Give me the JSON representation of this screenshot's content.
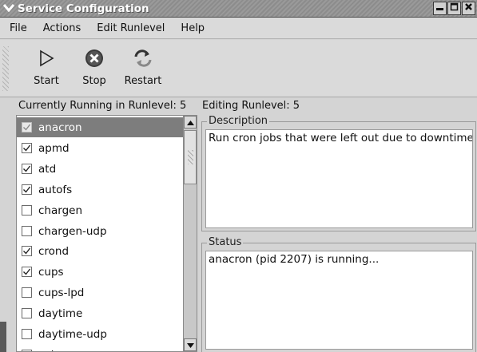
{
  "window": {
    "title": "Service Configuration"
  },
  "menu": [
    {
      "label": "File"
    },
    {
      "label": "Actions"
    },
    {
      "label": "Edit Runlevel"
    },
    {
      "label": "Help"
    }
  ],
  "toolbar": {
    "start_label": "Start",
    "stop_label": "Stop",
    "restart_label": "Restart"
  },
  "runlevel": {
    "current": "Currently Running in Runlevel: 5",
    "editing": "Editing Runlevel: 5"
  },
  "services": [
    {
      "name": "anacron",
      "checked": true,
      "selected": true
    },
    {
      "name": "apmd",
      "checked": true
    },
    {
      "name": "atd",
      "checked": true
    },
    {
      "name": "autofs",
      "checked": true
    },
    {
      "name": "chargen",
      "checked": false
    },
    {
      "name": "chargen-udp",
      "checked": false
    },
    {
      "name": "crond",
      "checked": true
    },
    {
      "name": "cups",
      "checked": true
    },
    {
      "name": "cups-lpd",
      "checked": false
    },
    {
      "name": "daytime",
      "checked": false
    },
    {
      "name": "daytime-udp",
      "checked": false
    },
    {
      "name": "echo",
      "checked": false
    }
  ],
  "description": {
    "label": "Description",
    "text": "Run cron jobs that were left out due to downtime"
  },
  "status": {
    "label": "Status",
    "text": "anacron (pid 2207) is running..."
  },
  "icons": {
    "window_menu": "chevron-down-icon",
    "minimize": "minimize-icon",
    "maximize": "maximize-icon",
    "close": "close-icon",
    "start": "play-icon",
    "stop": "stop-icon",
    "restart": "restart-icon",
    "scroll_up": "arrow-up-icon",
    "scroll_down": "arrow-down-icon"
  }
}
